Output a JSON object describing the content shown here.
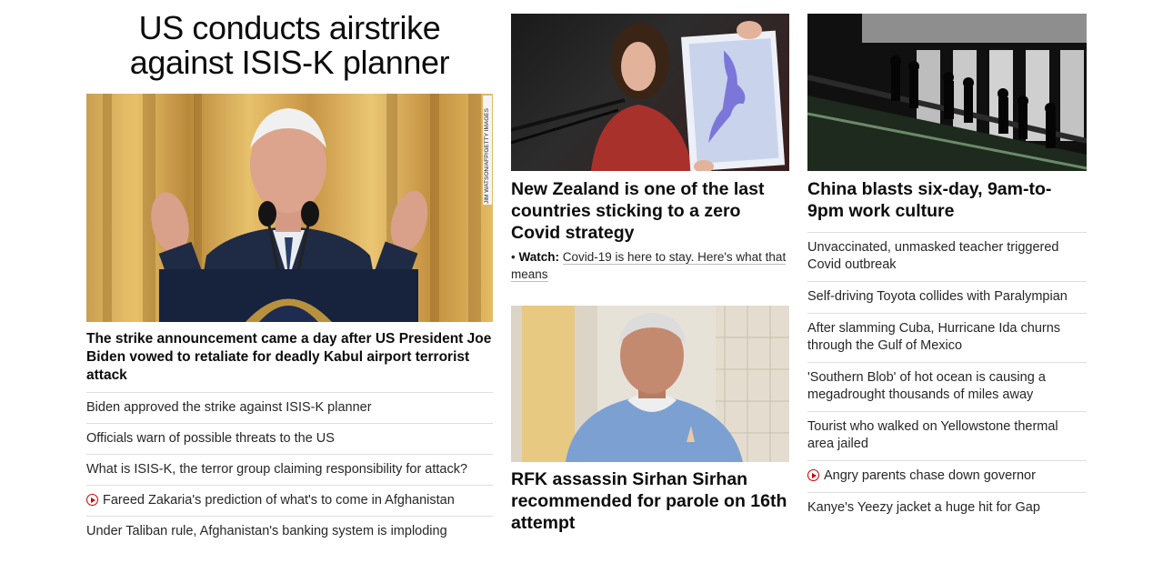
{
  "lead": {
    "headline": "US conducts airstrike against ISIS-K planner",
    "image_credit": "JIM WATSON/AFP/GETTY IMAGES",
    "summary": "The strike announcement came a day after US President Joe Biden vowed to retaliate for deadly Kabul airport terrorist attack",
    "related": [
      {
        "text": "Biden approved the strike against ISIS-K planner",
        "video": false
      },
      {
        "text": "Officials warn of possible threats to the US",
        "video": false
      },
      {
        "text": "What is ISIS-K, the terror group claiming responsibility for attack?",
        "video": false
      },
      {
        "text": "Fareed Zakaria's prediction of what's to come in Afghanistan",
        "video": true
      },
      {
        "text": "Under Taliban rule, Afghanistan's banking system is imploding",
        "video": false
      }
    ]
  },
  "middle": {
    "story1": {
      "title": "New Zealand is one of the last countries sticking to a zero Covid strategy",
      "watch_label": "Watch:",
      "watch_text": "Covid-19 is here to stay. Here's what that means"
    },
    "story2": {
      "title": "RFK assassin Sirhan Sirhan recommended for parole on 16th attempt"
    }
  },
  "right": {
    "feature_title": "China blasts six-day, 9am-to-9pm work culture",
    "items": [
      {
        "text": "Unvaccinated, unmasked teacher triggered Covid outbreak",
        "video": false
      },
      {
        "text": "Self-driving Toyota collides with Paralympian",
        "video": false
      },
      {
        "text": "After slamming Cuba, Hurricane Ida churns through the Gulf of Mexico",
        "video": false
      },
      {
        "text": "'Southern Blob' of hot ocean is causing a megadrought thousands of miles away",
        "video": false
      },
      {
        "text": "Tourist who walked on Yellowstone thermal area jailed",
        "video": false
      },
      {
        "text": "Angry parents chase down governor",
        "video": true
      },
      {
        "text": "Kanye's Yeezy jacket a huge hit for Gap",
        "video": false
      }
    ]
  },
  "colors": {
    "video_icon": "#cc0000",
    "divider": "#dedede"
  }
}
